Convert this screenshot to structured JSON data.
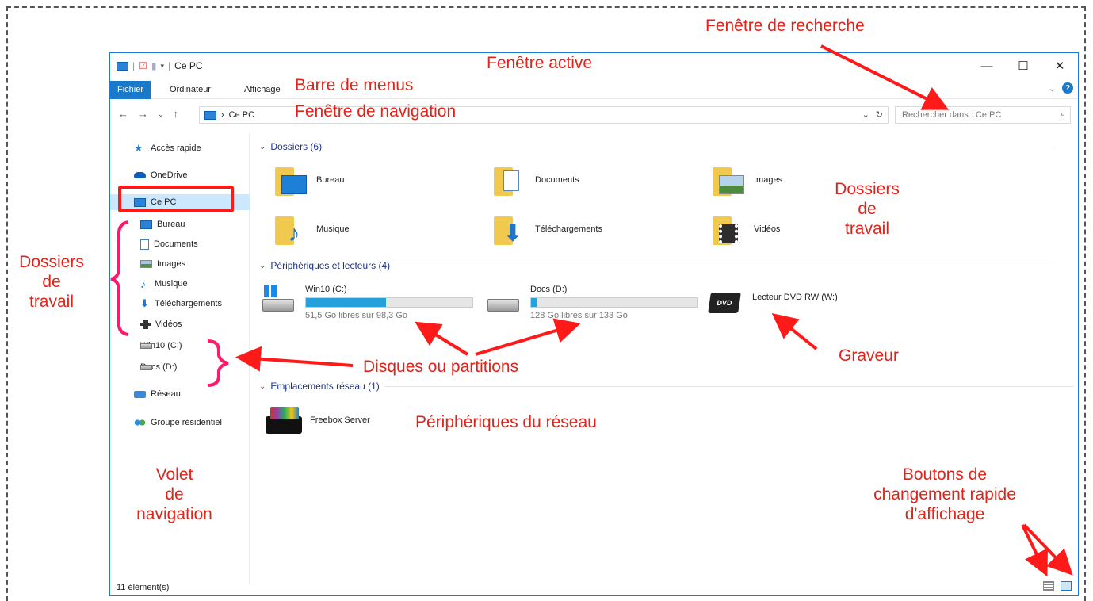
{
  "window": {
    "title": "Ce PC",
    "controls": {
      "minimize": "—",
      "maximize": "☐",
      "close": "✕"
    }
  },
  "ribbon": {
    "tabs": [
      "Fichier",
      "Ordinateur",
      "Affichage"
    ],
    "expand": "⌄",
    "help": "?"
  },
  "address": {
    "crumb": "Ce PC",
    "separator": "›",
    "search_placeholder": "Rechercher dans : Ce PC"
  },
  "nav_pane": {
    "items": [
      {
        "label": "Accès rapide",
        "icon": "star-icon"
      },
      {
        "label": "OneDrive",
        "icon": "cloud-icon"
      },
      {
        "label": "Ce PC",
        "icon": "computer-icon",
        "selected": true
      },
      {
        "label": "Bureau",
        "icon": "desktop-icon"
      },
      {
        "label": "Documents",
        "icon": "document-icon"
      },
      {
        "label": "Images",
        "icon": "image-icon"
      },
      {
        "label": "Musique",
        "icon": "music-icon"
      },
      {
        "label": "Téléchargements",
        "icon": "download-icon"
      },
      {
        "label": "Vidéos",
        "icon": "video-icon"
      },
      {
        "label": "Win10 (C:)",
        "icon": "drive-icon"
      },
      {
        "label": "Docs (D:)",
        "icon": "drive-icon"
      },
      {
        "label": "Réseau",
        "icon": "network-icon"
      },
      {
        "label": "Groupe résidentiel",
        "icon": "homegroup-icon"
      }
    ]
  },
  "content": {
    "groups": {
      "folders": "Dossiers (6)",
      "devices": "Périphériques et lecteurs (4)",
      "network": "Emplacements réseau (1)"
    },
    "folders": [
      "Bureau",
      "Documents",
      "Images",
      "Musique",
      "Téléchargements",
      "Vidéos"
    ],
    "drives": [
      {
        "name": "Win10 (C:)",
        "sub": "51,5 Go libres sur 98,3 Go",
        "used_fraction": 0.48
      },
      {
        "name": "Docs (D:)",
        "sub": "128 Go libres sur 133 Go",
        "used_fraction": 0.04
      },
      {
        "name": "Lecteur DVD RW (W:)"
      }
    ],
    "dvd_label": "DVD",
    "network_devices": [
      "Freebox Server"
    ]
  },
  "status": {
    "count": "11 élément(s)"
  },
  "annotations": {
    "search_window": "Fenêtre de recherche",
    "active_window": "Fenêtre active",
    "menu_bar": "Barre de menus",
    "nav_window": "Fenêtre de navigation",
    "work_folders_right": [
      "Dossiers",
      "de",
      "travail"
    ],
    "work_folders_left": [
      "Dossiers",
      "de",
      "travail"
    ],
    "disks": "Disques ou partitions",
    "burner": "Graveur",
    "network_devices": "Périphériques du réseau",
    "nav_pane": [
      "Volet",
      "de",
      "navigation"
    ],
    "view_buttons": [
      "Boutons de",
      "changement rapide",
      "d'affichage"
    ]
  }
}
